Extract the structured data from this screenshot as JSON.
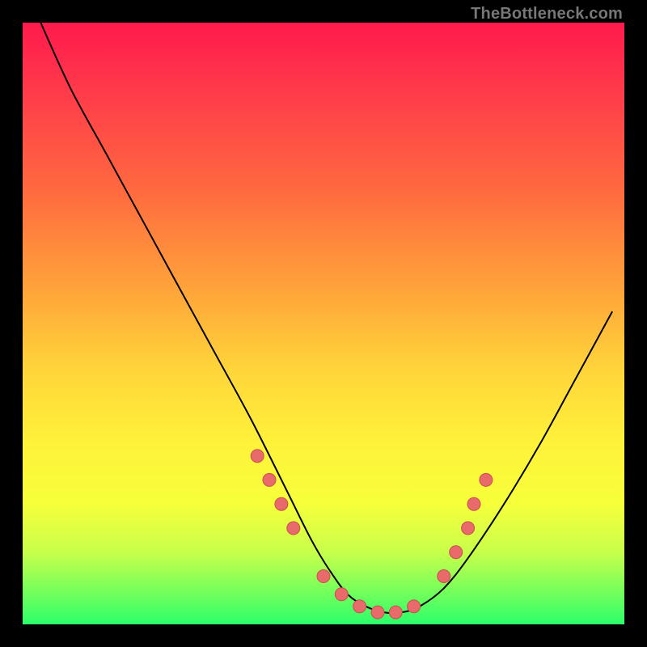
{
  "watermark": "TheBottleneck.com",
  "colors": {
    "frame": "#000000",
    "curve": "#000000",
    "marker_fill": "#e86a6a",
    "marker_stroke": "#c94f4f"
  },
  "chart_data": {
    "type": "line",
    "title": "",
    "xlabel": "",
    "ylabel": "",
    "xlim": [
      0,
      100
    ],
    "ylim": [
      0,
      100
    ],
    "grid": false,
    "legend": false,
    "series": [
      {
        "name": "curve",
        "x": [
          3,
          8,
          14,
          20,
          26,
          32,
          38,
          44,
          48,
          51,
          54,
          57,
          60,
          63,
          66,
          70,
          74,
          80,
          86,
          92,
          98
        ],
        "y": [
          100,
          89,
          78,
          67,
          56,
          45,
          34,
          22,
          14,
          9,
          5,
          3,
          2,
          2,
          3,
          6,
          11,
          20,
          30,
          41,
          52
        ]
      }
    ],
    "markers": [
      {
        "x": 39,
        "y": 28
      },
      {
        "x": 41,
        "y": 24
      },
      {
        "x": 43,
        "y": 20
      },
      {
        "x": 45,
        "y": 16
      },
      {
        "x": 50,
        "y": 8
      },
      {
        "x": 53,
        "y": 5
      },
      {
        "x": 56,
        "y": 3
      },
      {
        "x": 59,
        "y": 2
      },
      {
        "x": 62,
        "y": 2
      },
      {
        "x": 65,
        "y": 3
      },
      {
        "x": 70,
        "y": 8
      },
      {
        "x": 72,
        "y": 12
      },
      {
        "x": 74,
        "y": 16
      },
      {
        "x": 75,
        "y": 20
      },
      {
        "x": 77,
        "y": 24
      }
    ]
  }
}
